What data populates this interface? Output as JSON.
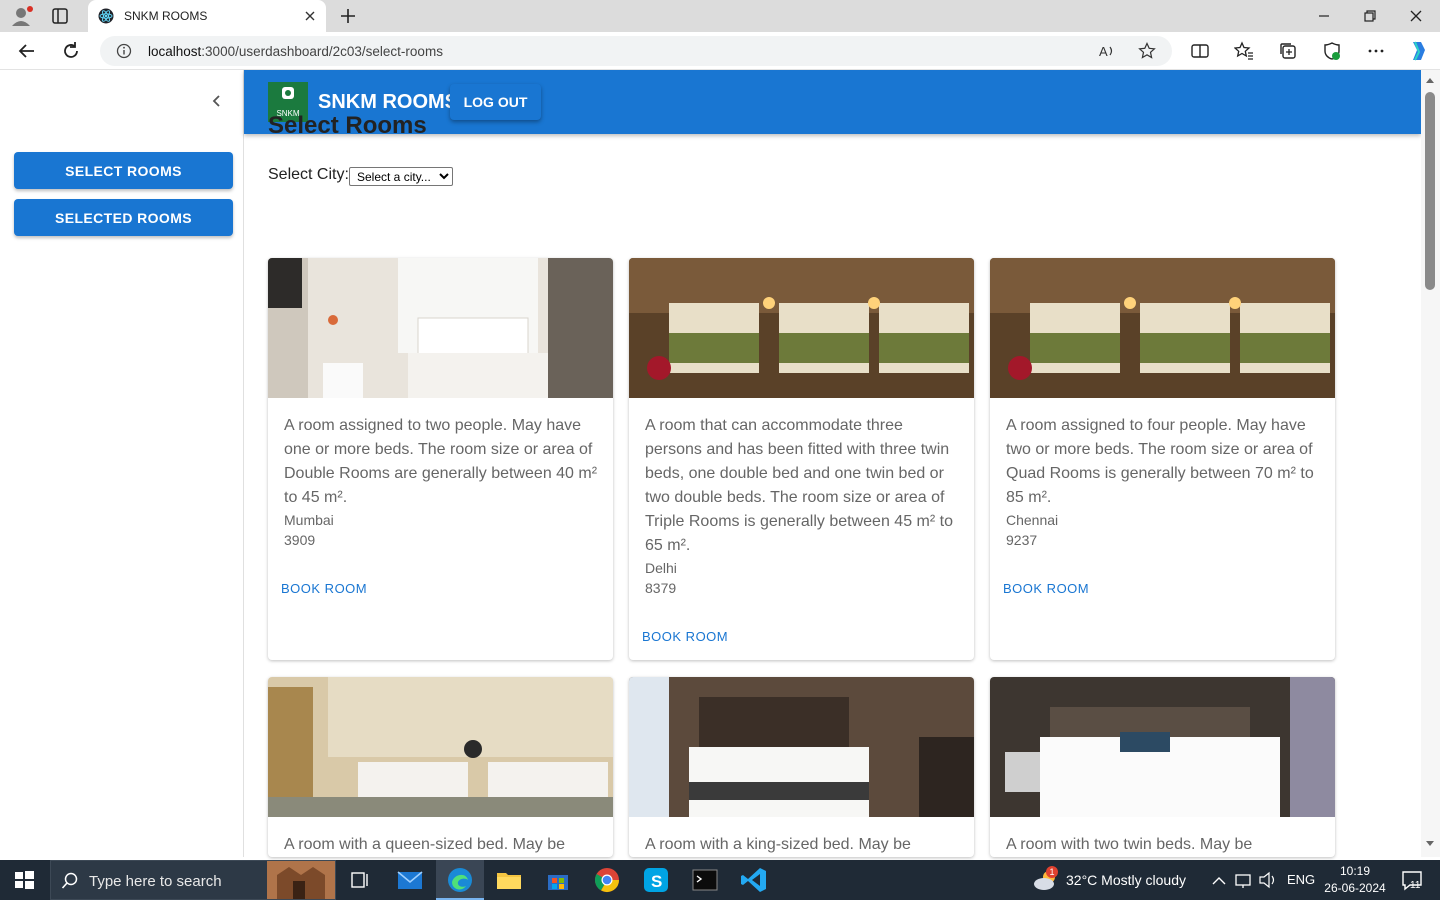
{
  "browser": {
    "tab_title": "SNKM ROOMS",
    "url_host": "localhost",
    "url_path": ":3000/userdashboard/2c03/select-rooms"
  },
  "sidebar": {
    "items": [
      {
        "label": "SELECT ROOMS"
      },
      {
        "label": "SELECTED ROOMS"
      }
    ]
  },
  "appbar": {
    "logo_text": "SNKM",
    "brand": "SNKM ROOMS",
    "logout_label": "LOG OUT",
    "color": "#1976d2"
  },
  "main": {
    "title": "Select Rooms",
    "city_label": "Select City:",
    "city_select_value": "Select a city...",
    "rooms": [
      {
        "description": "A room assigned to two people. May have one or more beds. The room size or area of Double Rooms are generally between 40 m² to 45 m².",
        "city": "Mumbai",
        "price": "3909",
        "book_label": "BOOK ROOM"
      },
      {
        "description": "A room that can accommodate three persons and has been fitted with three twin beds, one double bed and one twin bed or two double beds. The room size or area of Triple Rooms is generally between 45 m² to 65 m².",
        "city": "Delhi",
        "price": "8379",
        "book_label": "BOOK ROOM"
      },
      {
        "description": "A room assigned to four people. May have two or more beds. The room size or area of Quad Rooms is generally between 70 m² to 85 m².",
        "city": "Chennai",
        "price": "9237",
        "book_label": "BOOK ROOM"
      },
      {
        "description": "A room with a queen-sized bed. May be"
      },
      {
        "description": "A room with a king-sized bed. May be"
      },
      {
        "description": "A room with two twin beds. May be"
      }
    ]
  },
  "taskbar": {
    "search_placeholder": "Type here to search",
    "weather": "32°C  Mostly cloudy",
    "weather_badge": "1",
    "lang": "ENG",
    "time": "10:19",
    "date": "26-06-2024",
    "notif_count": "11"
  }
}
